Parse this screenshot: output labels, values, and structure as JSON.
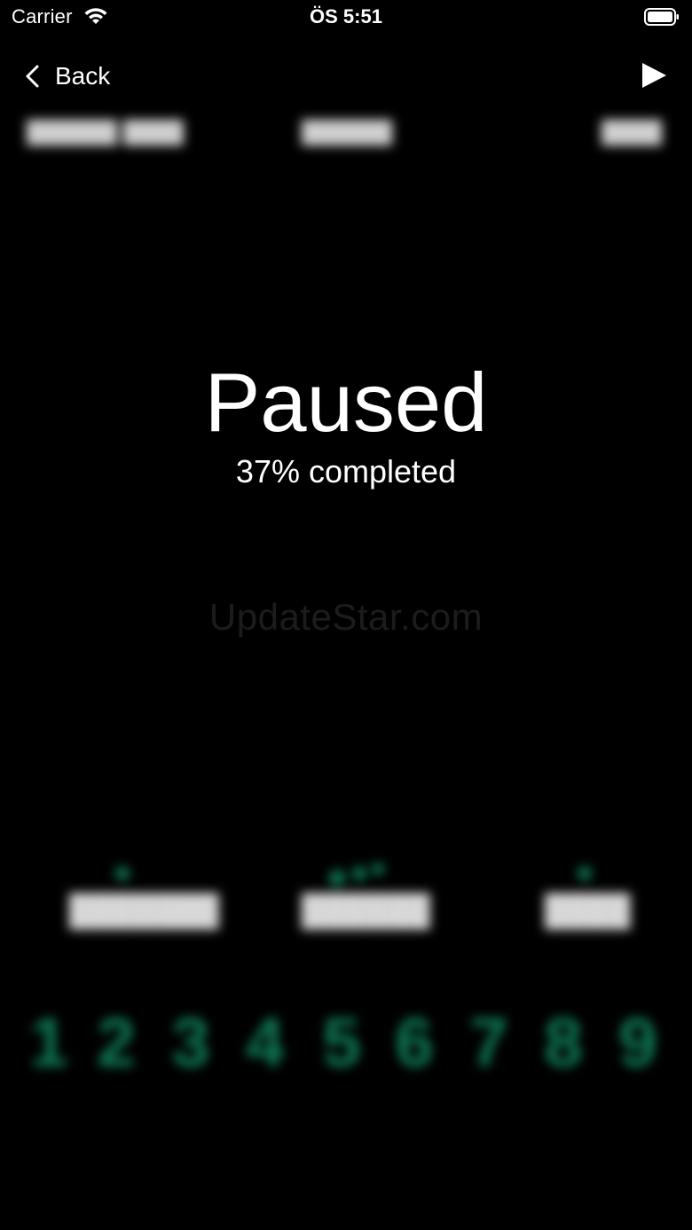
{
  "status_bar": {
    "carrier": "Carrier",
    "time": "ÖS 5:51",
    "wifi_icon": "wifi-icon",
    "battery_icon": "battery-full-icon"
  },
  "nav": {
    "back_label": "Back",
    "back_icon": "chevron-left-icon",
    "play_icon": "play-icon"
  },
  "game": {
    "status_title": "Paused",
    "progress_text": "37% completed",
    "progress_percent": 37
  },
  "watermark": "UpdateStar.com",
  "blurred_background": {
    "digits": [
      "1",
      "2",
      "3",
      "4",
      "5",
      "6",
      "7",
      "8",
      "9"
    ],
    "digit_color": "#0f7a56"
  }
}
